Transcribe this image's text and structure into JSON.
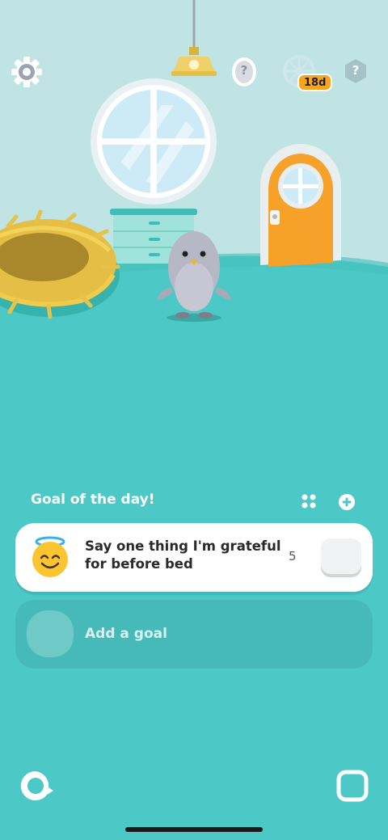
{
  "top_bar": {
    "settings_icon": "gear-icon",
    "egg_icon": "mystery-egg-icon",
    "egg_mark": "?",
    "wheel_icon": "wheel-icon",
    "streak_badge": "18d",
    "help_icon": "help-icon",
    "help_mark": "?"
  },
  "goals": {
    "header_title": "Goal of the day!",
    "grid_icon": "grid-icon",
    "add_icon": "plus-circle-icon",
    "items": [
      {
        "emoji": "smiling-face-with-halo",
        "label": "Say one thing I'm grateful for before bed",
        "count": "5"
      }
    ],
    "add_goal_label": "Add a goal"
  },
  "bottom_nav": {
    "left_icon": "chat-bubble-icon",
    "right_icon": "square-icon"
  },
  "colors": {
    "floor": "#4cc9c6",
    "wall": "#bfe4e3",
    "door": "#f6a12a",
    "streak_badge": "#f6a523"
  }
}
